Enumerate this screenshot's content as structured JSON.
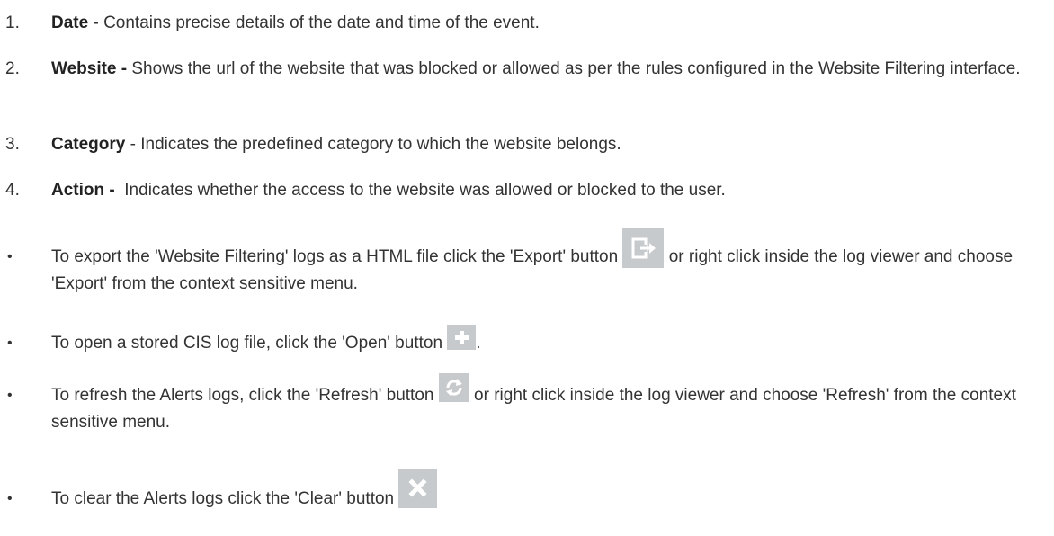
{
  "numbered_list": [
    {
      "marker": "1.",
      "term": "Date",
      "text": " - Contains precise details of the date and time of the event."
    },
    {
      "marker": "2.",
      "term": "Website -",
      "text": " Shows the url of the website that was blocked or allowed as per the rules configured in the Website Filtering interface."
    },
    {
      "marker": "3.",
      "term": "Category",
      "text": " - Indicates the predefined category to which the website belongs."
    },
    {
      "marker": "4.",
      "term": "Action -",
      "text": "  Indicates whether the access to the website was allowed or blocked to the user."
    }
  ],
  "bullets": [
    {
      "marker": "•",
      "text_before": "To export the 'Website Filtering' logs as a HTML file click the 'Export' button ",
      "icon": "export-icon",
      "text_after": " or right click inside the log viewer and choose 'Export' from the context sensitive menu."
    },
    {
      "marker": "•",
      "text_before": "To open a stored CIS log file, click the 'Open' button ",
      "icon": "open-plus-icon",
      "text_after": "."
    },
    {
      "marker": "•",
      "text_before": "To refresh the Alerts logs, click the 'Refresh' button ",
      "icon": "refresh-icon",
      "text_after": " or right click inside the log viewer and choose 'Refresh' from the context sensitive menu."
    },
    {
      "marker": "•",
      "text_before": "To clear the Alerts logs click the 'Clear' button ",
      "icon": "clear-x-icon",
      "text_after": ""
    }
  ],
  "colors": {
    "text": "#333333",
    "icon_background": "#c7cacc",
    "icon_glyph": "#ffffff"
  }
}
